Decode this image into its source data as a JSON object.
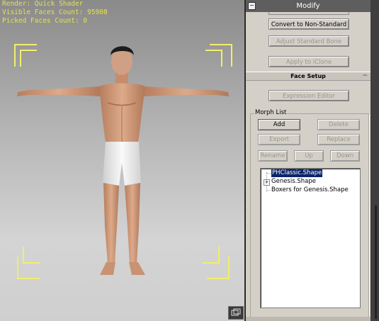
{
  "viewport": {
    "stats": [
      "Render: Quick Shader",
      "Visible Faces Count: 95908",
      "Picked Faces Count: 0"
    ],
    "corner_color": "#f2ee6a",
    "background": "light gray gradient"
  },
  "panel": {
    "title": "Modify",
    "collapse_glyph": "−",
    "buttons": {
      "convert": "Convert to Non-Standard",
      "adjust_bone": "Adjust Standard Bone",
      "apply_iclone": "Apply to iClone",
      "expression_editor": "Expression Editor"
    },
    "face_setup": {
      "title": "Face Setup",
      "collapse_glyph": "−"
    },
    "morph_list": {
      "title": "Morph List",
      "buttons": {
        "add": "Add",
        "delete": "Delete",
        "export": "Export",
        "replace": "Replace",
        "rename": "Rename",
        "up": "Up",
        "down": "Down"
      },
      "tree": {
        "expander": "+",
        "items": [
          "PHClassic.Shape",
          "Genesis.Shape",
          "Boxers for Genesis.Shape"
        ],
        "selected_index": 0
      }
    }
  }
}
